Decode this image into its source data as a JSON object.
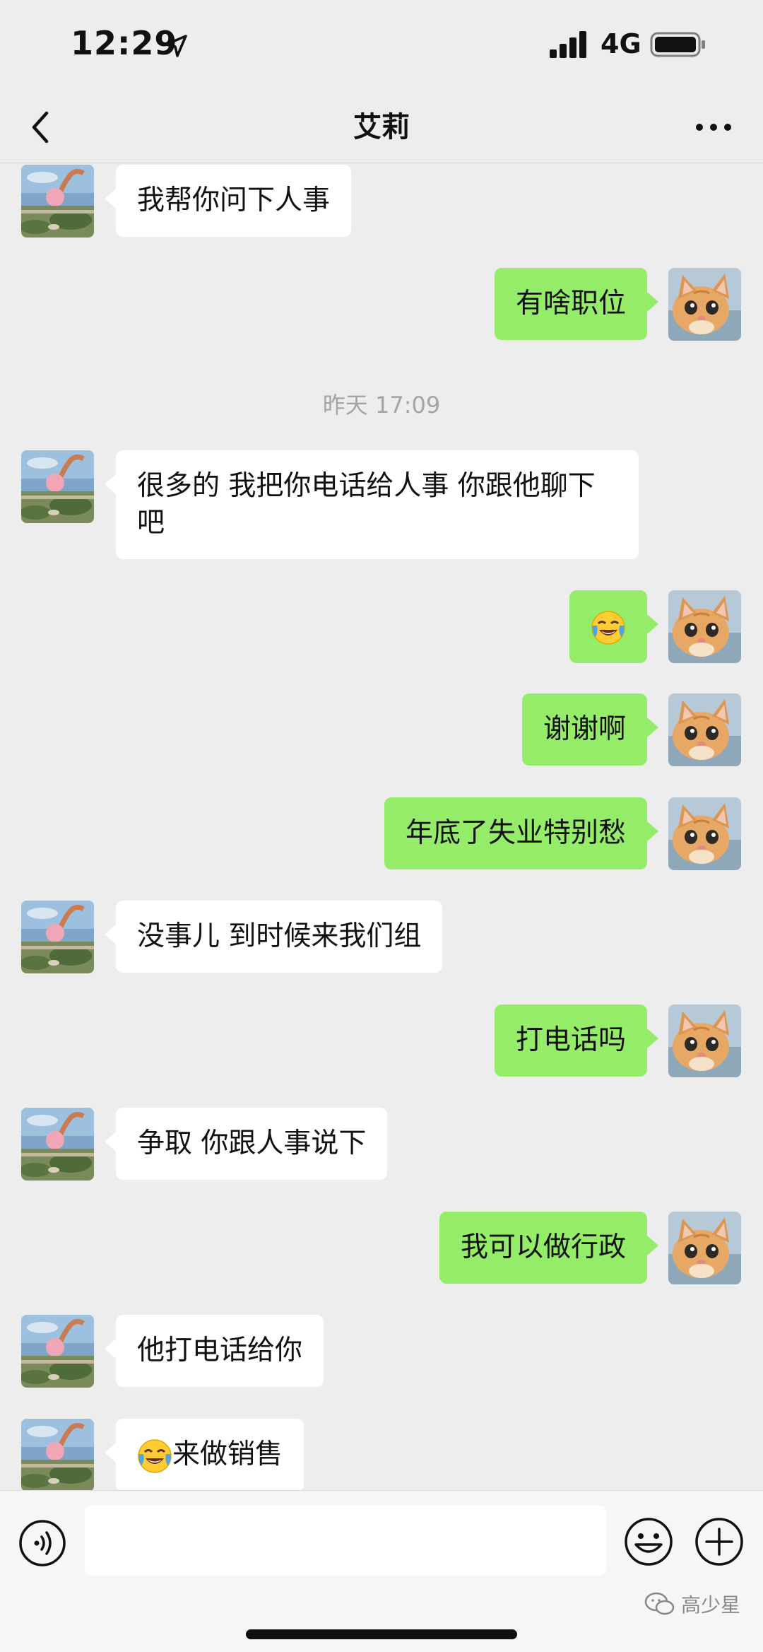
{
  "status_bar": {
    "time": "12:29",
    "network": "4G"
  },
  "header": {
    "title": "艾莉"
  },
  "messages": [
    {
      "side": "left",
      "text": "我帮你问下人事"
    },
    {
      "side": "right",
      "text": "有啥职位"
    },
    {
      "type": "time",
      "text": "昨天 17:09"
    },
    {
      "side": "left",
      "text": "很多的 我把你电话给人事 你跟他聊下吧"
    },
    {
      "side": "right",
      "emoji": "face-with-tears-of-joy"
    },
    {
      "side": "right",
      "text": "谢谢啊"
    },
    {
      "side": "right",
      "text": "年底了失业特别愁"
    },
    {
      "side": "left",
      "text": "没事儿 到时候来我们组"
    },
    {
      "side": "right",
      "text": "打电话吗"
    },
    {
      "side": "left",
      "text": "争取 你跟人事说下"
    },
    {
      "side": "right",
      "text": "我可以做行政"
    },
    {
      "side": "left",
      "text": "他打电话给你"
    },
    {
      "side": "left",
      "emoji": "face-with-tears-of-joy",
      "text": "来做销售"
    }
  ],
  "input": {
    "value": "",
    "placeholder": ""
  },
  "watermark": {
    "text": "高少星"
  },
  "colors": {
    "background": "#ededed",
    "my_bubble": "#95ec69",
    "their_bubble": "#ffffff",
    "timestamp": "#a4a4a4"
  }
}
